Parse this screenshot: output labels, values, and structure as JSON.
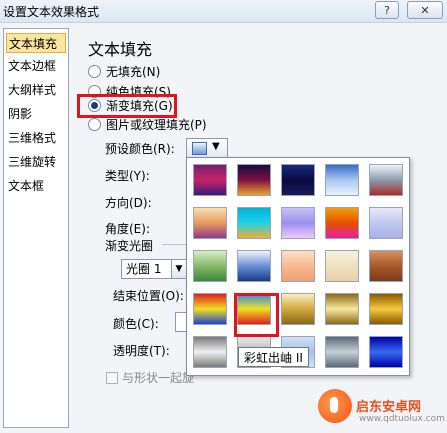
{
  "window": {
    "title": "设置文本效果格式",
    "help_label": "?",
    "close_label": "✕"
  },
  "nav": {
    "items": [
      {
        "label": "文本填充",
        "selected": true
      },
      {
        "label": "文本边框"
      },
      {
        "label": "大纲样式"
      },
      {
        "label": "阴影"
      },
      {
        "label": "三维格式"
      },
      {
        "label": "三维旋转"
      },
      {
        "label": "文本框"
      }
    ]
  },
  "fill": {
    "heading": "文本填充",
    "options": [
      {
        "label": "无填充(N)",
        "checked": false
      },
      {
        "label": "纯色填充(S)",
        "checked": false
      },
      {
        "label": "渐变填充(G)",
        "checked": true
      },
      {
        "label": "图片或纹理填充(P)",
        "checked": false
      }
    ],
    "preset_label": "预设颜色(R):",
    "type_label": "类型(Y):",
    "direction_label": "方向(D):",
    "angle_label": "角度(E):",
    "gradient_stops_label": "渐变光圈",
    "stop_value": "光圈 1",
    "end_position_label": "结束位置(O):",
    "color_label": "颜色(C):",
    "transparency_label": "透明度(T):",
    "rotate_with_shape_label": "与形状一起旋"
  },
  "preset_popup": {
    "tooltip": "彩虹出岫 II",
    "swatches": [
      {
        "name": "swatch-1",
        "colors": [
          "#7a1e6e",
          "#c6236a",
          "#3b1a78"
        ]
      },
      {
        "name": "swatch-2",
        "colors": [
          "#1a0c3c",
          "#7a1042",
          "#f0a030"
        ]
      },
      {
        "name": "swatch-3",
        "colors": [
          "#1a2a7a",
          "#0a0a40",
          "#1a1a5a"
        ]
      },
      {
        "name": "swatch-4",
        "colors": [
          "#3a6ac8",
          "#a8c8f0",
          "#e8f2fc"
        ]
      },
      {
        "name": "swatch-5",
        "colors": [
          "#f0f4f8",
          "#8a9cb0",
          "#b02a2a"
        ]
      },
      {
        "name": "swatch-6",
        "colors": [
          "#f8e0b0",
          "#e89a60",
          "#8a3a8a"
        ]
      },
      {
        "name": "swatch-7",
        "colors": [
          "#00b4d8",
          "#20d0e8",
          "#f0b030"
        ]
      },
      {
        "name": "swatch-8",
        "colors": [
          "#c8c0f8",
          "#9a90f0",
          "#f0c8f8"
        ]
      },
      {
        "name": "swatch-9",
        "colors": [
          "#f0a000",
          "#e85000",
          "#e020a0"
        ]
      },
      {
        "name": "swatch-10",
        "colors": [
          "#e8e8f8",
          "#c0c8f0",
          "#a8b0e8"
        ]
      },
      {
        "name": "swatch-11",
        "colors": [
          "#d8ecc8",
          "#88b868",
          "#3a8a3a"
        ]
      },
      {
        "name": "swatch-12",
        "colors": [
          "#f0f4f8",
          "#6a90d8",
          "#1a3a8a"
        ]
      },
      {
        "name": "swatch-13",
        "colors": [
          "#fce0c8",
          "#f8b890",
          "#f0a070"
        ]
      },
      {
        "name": "swatch-14",
        "colors": [
          "#f8f0e0",
          "#f0e0c0",
          "#e8d0a8"
        ]
      },
      {
        "name": "swatch-15",
        "colors": [
          "#d89060",
          "#a85a2a",
          "#7a3a18"
        ]
      },
      {
        "name": "swatch-16",
        "colors": [
          "#e02020",
          "#f0e020",
          "#2040d0"
        ]
      },
      {
        "name": "swatch-17",
        "colors": [
          "#2a8ae8",
          "#f0e020",
          "#e02020"
        ]
      },
      {
        "name": "swatch-18",
        "colors": [
          "#f8f0c0",
          "#d0a840",
          "#8a6a18"
        ]
      },
      {
        "name": "swatch-19",
        "colors": [
          "#8a6a18",
          "#f8e8a0",
          "#8a6a18"
        ]
      },
      {
        "name": "swatch-20",
        "colors": [
          "#8a5a00",
          "#f8c840",
          "#8a5a00"
        ]
      },
      {
        "name": "swatch-21",
        "colors": [
          "#7a7a7a",
          "#f0f0f0",
          "#7a7a7a"
        ]
      },
      {
        "name": "swatch-22",
        "colors": [
          "#eaeaea",
          "#b8b8b8",
          "#eaeaea"
        ]
      },
      {
        "name": "swatch-23",
        "colors": [
          "#d0e0f8",
          "#a8c0e8",
          "#d0e0f8"
        ]
      },
      {
        "name": "swatch-24",
        "colors": [
          "#5a6a7a",
          "#c8d0d8",
          "#5a6a7a"
        ]
      },
      {
        "name": "swatch-25",
        "colors": [
          "#0000a8",
          "#3a6af0",
          "#0000a8"
        ]
      }
    ],
    "selected_index": 16
  },
  "watermark": {
    "name": "启东安卓网",
    "url": "www.qdtuolux.com"
  }
}
